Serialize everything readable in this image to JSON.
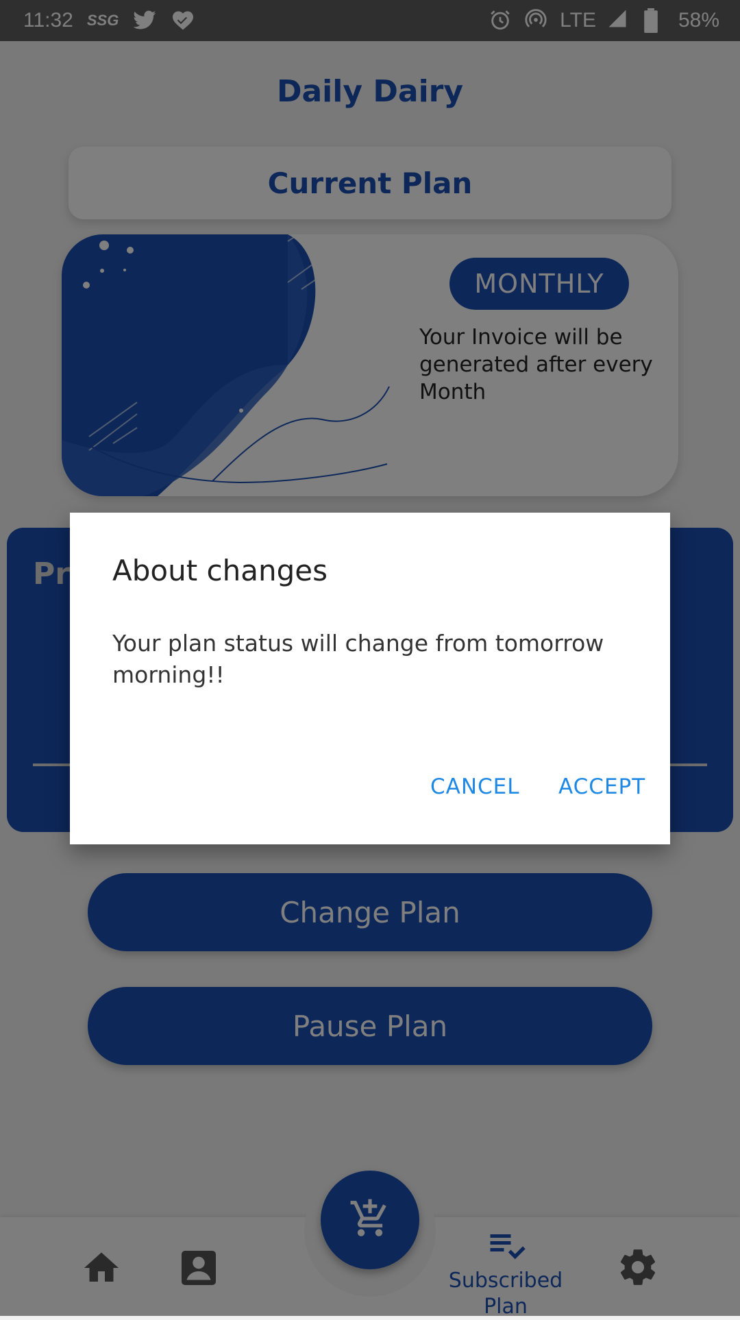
{
  "status_bar": {
    "time": "11:32",
    "carrier_label": "SSG",
    "network": "LTE",
    "battery": "58%"
  },
  "app": {
    "title": "Daily Dairy"
  },
  "current_plan": {
    "heading": "Current Plan",
    "badge": "MONTHLY",
    "description": "Your Invoice will be generated after every Month"
  },
  "progress_card": {
    "title_visible": "Pr"
  },
  "actions": {
    "change_plan": "Change Plan",
    "pause_plan": "Pause Plan"
  },
  "bottom_nav": {
    "active_label": "Subscribed Plan",
    "items": [
      "home-icon",
      "profile-icon",
      "add-to-cart-icon",
      "subscribed-plan-icon",
      "settings-icon"
    ]
  },
  "dialog": {
    "title": "About changes",
    "message": "Your plan status will change from tomorrow morning!!",
    "cancel_label": "CANCEL",
    "accept_label": "ACCEPT"
  },
  "colors": {
    "primary": "#1a4fb2",
    "dialog_button": "#1e88e5",
    "scrim": "rgba(0,0,0,0.5)"
  }
}
